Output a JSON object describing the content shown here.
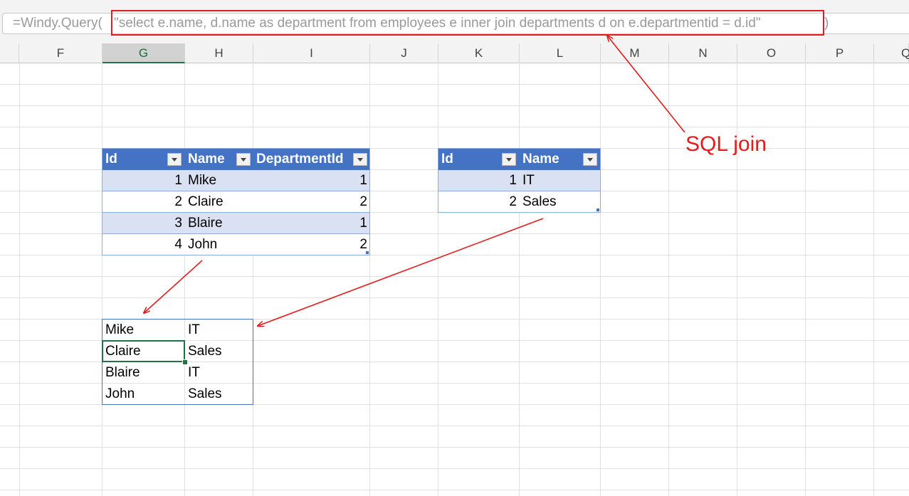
{
  "formula_bar": {
    "prefix": "=Windy.Query(",
    "query": "\"select e.name, d.name as department from employees e inner join departments d on e.departmentid = d.id\"",
    "suffix": ")"
  },
  "columns": [
    "F",
    "G",
    "H",
    "I",
    "J",
    "K",
    "L",
    "M",
    "N",
    "O",
    "P",
    "Q"
  ],
  "selected_column": "G",
  "employees_table": {
    "headers": [
      "Id",
      "Name",
      "DepartmentId"
    ],
    "rows": [
      {
        "id": "1",
        "name": "Mike",
        "department_id": "1"
      },
      {
        "id": "2",
        "name": "Claire",
        "department_id": "2"
      },
      {
        "id": "3",
        "name": "Blaire",
        "department_id": "1"
      },
      {
        "id": "4",
        "name": "John",
        "department_id": "2"
      }
    ]
  },
  "departments_table": {
    "headers": [
      "Id",
      "Name"
    ],
    "rows": [
      {
        "id": "1",
        "name": "IT"
      },
      {
        "id": "2",
        "name": "Sales"
      }
    ]
  },
  "result": {
    "rows": [
      {
        "name": "Mike",
        "department": "IT"
      },
      {
        "name": "Claire",
        "department": "Sales"
      },
      {
        "name": "Blaire",
        "department": "IT"
      },
      {
        "name": "John",
        "department": "Sales"
      }
    ],
    "active_row": 1
  },
  "annotation": {
    "label": "SQL join",
    "color": "#e21d1d"
  },
  "colors": {
    "table_header": "#4472c4",
    "table_band": "#d9e1f2",
    "selection": "#217346"
  }
}
